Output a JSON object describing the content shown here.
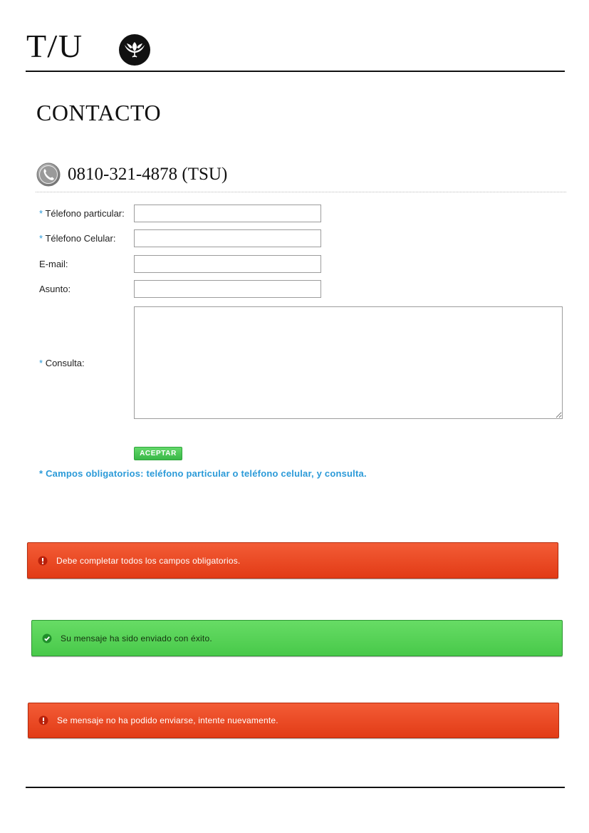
{
  "header": {
    "logo_text": "T/U",
    "emblem_icon": "lotus-flower-icon"
  },
  "page": {
    "title": "CONTACTO",
    "phone_icon": "phone-icon",
    "phone": "0810-321-4878 (TSU)"
  },
  "form": {
    "required_marker": "*",
    "fields": [
      {
        "label": "Télefono particular:",
        "required": true,
        "value": "",
        "placeholder": ""
      },
      {
        "label": "Télefono Celular:",
        "required": true,
        "value": "",
        "placeholder": ""
      },
      {
        "label": "E-mail:",
        "required": false,
        "value": "",
        "placeholder": ""
      },
      {
        "label": "Asunto:",
        "required": false,
        "value": "",
        "placeholder": ""
      },
      {
        "label": "Consulta:",
        "required": true,
        "value": "",
        "placeholder": ""
      }
    ],
    "submit_label": "ACEPTAR",
    "required_note": "* Campos obligatorios: teléfono particular o teléfono celular, y consulta."
  },
  "alerts": [
    {
      "type": "error",
      "icon": "exclamation-icon",
      "text": "Debe completar todos los campos obligatorios."
    },
    {
      "type": "success",
      "icon": "check-icon",
      "text": "Su mensaje ha sido enviado con éxito."
    },
    {
      "type": "error",
      "icon": "exclamation-icon",
      "text": "Se mensaje no ha podido enviarse, intente nuevamente."
    }
  ],
  "colors": {
    "accent_blue": "#2b9ad8",
    "button_green": "#46c552",
    "error_red": "#e8431e",
    "success_green": "#55d155"
  }
}
